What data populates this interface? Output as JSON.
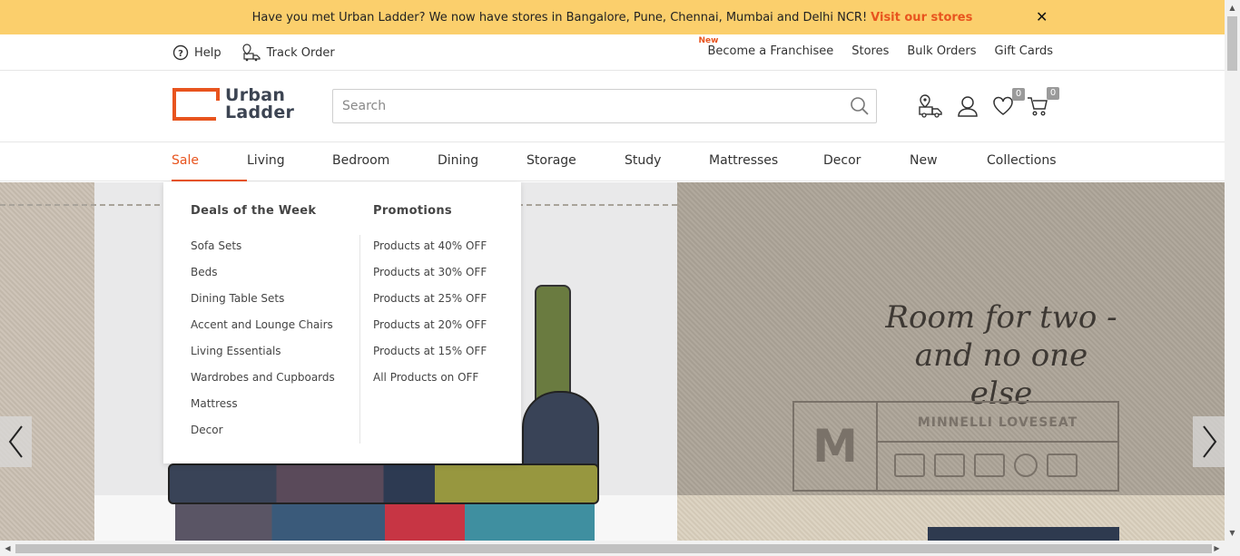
{
  "announcement": {
    "text": "Have you met Urban Ladder? We now have stores in Bangalore, Pune, Chennai, Mumbai and Delhi NCR!",
    "link": "Visit our stores",
    "close": "✕"
  },
  "utility": {
    "help": "Help",
    "track_order": "Track Order",
    "new_badge": "New",
    "franchise": "Become a Franchisee",
    "stores": "Stores",
    "bulk_orders": "Bulk Orders",
    "gift_cards": "Gift Cards"
  },
  "header": {
    "logo_line1": "Urban",
    "logo_line2": "Ladder",
    "search_placeholder": "Search",
    "wishlist_count": "0",
    "cart_count": "0"
  },
  "nav": {
    "items": [
      "Sale",
      "Living",
      "Bedroom",
      "Dining",
      "Storage",
      "Study",
      "Mattresses",
      "Decor",
      "New",
      "Collections"
    ],
    "active": "Sale"
  },
  "dropdown": {
    "col1_title": "Deals of the Week",
    "col1_items": [
      "Sofa Sets",
      "Beds",
      "Dining Table Sets",
      "Accent and Lounge Chairs",
      "Living Essentials",
      "Wardrobes and Cupboards",
      "Mattress",
      "Decor"
    ],
    "col2_title": "Promotions",
    "col2_items": [
      "Products at 40% OFF",
      "Products at 30% OFF",
      "Products at 25% OFF",
      "Products at 20% OFF",
      "Products at 15% OFF",
      "All Products on OFF"
    ]
  },
  "hero": {
    "tagline_line1": "Room for two -",
    "tagline_line2": "and no one else",
    "stamp_letter": "M",
    "stamp_name": "MINNELLI LOVESEAT"
  },
  "colors": {
    "accent": "#e8541e",
    "announce_bg": "#fbcf6c"
  }
}
